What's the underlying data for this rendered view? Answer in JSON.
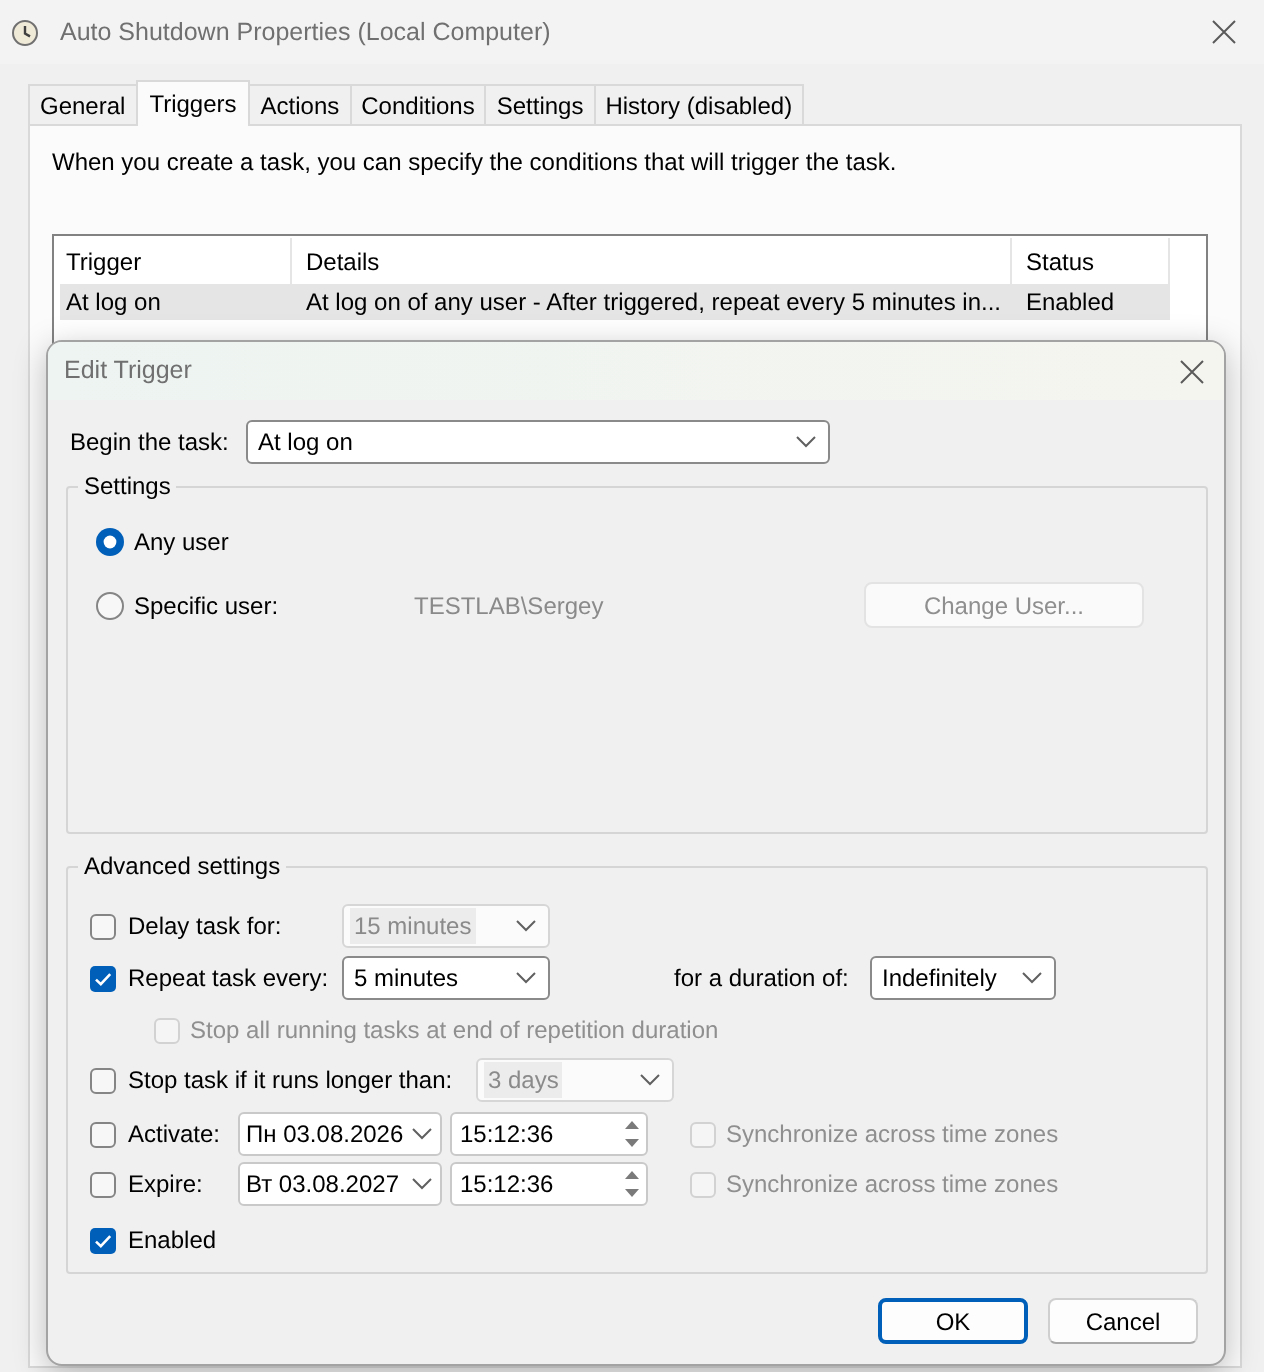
{
  "window": {
    "title": "Auto Shutdown Properties (Local Computer)"
  },
  "tabs": [
    {
      "label": "General",
      "selected": false
    },
    {
      "label": "Triggers",
      "selected": true
    },
    {
      "label": "Actions",
      "selected": false
    },
    {
      "label": "Conditions",
      "selected": false
    },
    {
      "label": "Settings",
      "selected": false
    },
    {
      "label": "History (disabled)",
      "selected": false
    }
  ],
  "triggers_tab": {
    "description": "When you create a task, you can specify the conditions that will trigger the task.",
    "table": {
      "columns": [
        "Trigger",
        "Details",
        "Status"
      ],
      "rows": [
        {
          "cells": [
            "At log on",
            "At log on of any user - After triggered, repeat every 5 minutes in...",
            "Enabled"
          ],
          "selected": true
        }
      ]
    }
  },
  "edit_trigger": {
    "title": "Edit Trigger",
    "begin_the_task": {
      "label": "Begin the task:",
      "value": "At log on"
    },
    "settings": {
      "title": "Settings",
      "options": [
        {
          "label": "Any user",
          "selected": true
        },
        {
          "label": "Specific user:",
          "selected": false,
          "user": "TESTLAB\\Sergey",
          "change_user_button": {
            "label": "Change User...",
            "disabled": true
          }
        }
      ]
    },
    "advanced_settings": {
      "title": "Advanced settings",
      "delay_task": {
        "label": "Delay task for:",
        "checked": false,
        "dropdown": {
          "value": "15 minutes",
          "disabled": true
        }
      },
      "repeat_task": {
        "label": "Repeat task every:",
        "checked": true,
        "dropdown": {
          "value": "5 minutes",
          "disabled": false
        },
        "duration": {
          "label": "for a duration of:",
          "value": "Indefinitely",
          "disabled": false
        }
      },
      "stop_all_running": {
        "label": "Stop all running tasks at end of repetition duration",
        "checked": false,
        "disabled": true
      },
      "stop_if_longer": {
        "label": "Stop task if it runs longer than:",
        "checked": false,
        "dropdown": {
          "value": "3 days",
          "disabled": true
        }
      },
      "activate": {
        "label": "Activate:",
        "checked": false,
        "date": "Пн 03.08.2026",
        "time": "15:12:36",
        "sync": {
          "label": "Synchronize across time zones",
          "checked": false,
          "disabled": true
        }
      },
      "expire": {
        "label": "Expire:",
        "checked": false,
        "date": "Вт 03.08.2027",
        "time": "15:12:36",
        "sync": {
          "label": "Synchronize across time zones",
          "checked": false,
          "disabled": true
        }
      },
      "enabled": {
        "label": "Enabled",
        "checked": true
      }
    },
    "buttons": [
      {
        "label": "OK",
        "default": true
      },
      {
        "label": "Cancel",
        "default": false
      }
    ]
  }
}
